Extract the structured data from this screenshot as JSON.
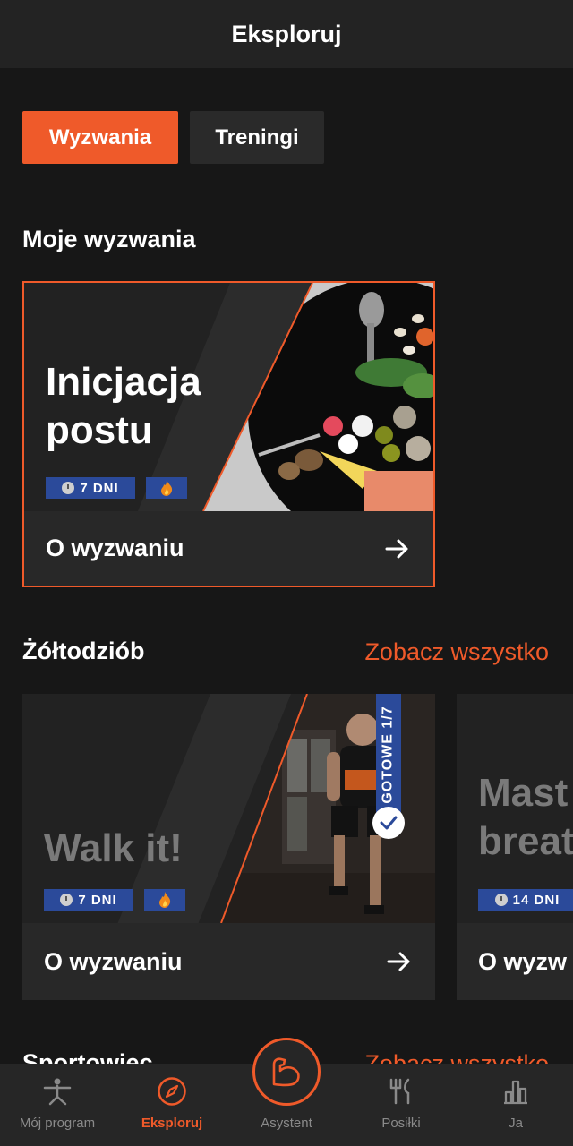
{
  "header": {
    "title": "Eksploruj"
  },
  "segments": [
    {
      "label": "Wyzwania",
      "active": true
    },
    {
      "label": "Treningi",
      "active": false
    }
  ],
  "my_challenges": {
    "section_title": "Moje wyzwania",
    "card": {
      "title_line1": "Inicjacja",
      "title_line2": "postu",
      "days_badge": "7 DNI",
      "difficulty_icon": "flame-icon",
      "action_label": "O wyzwaniu"
    }
  },
  "beginner": {
    "section_title": "Żółtodziób",
    "see_all": "Zobacz wszystko",
    "cards": [
      {
        "title": "Walk it!",
        "days_badge": "7 DNI",
        "difficulty_icon": "flame-icon",
        "progress": "GOTOWE 1/7",
        "action_label": "O wyzwaniu"
      },
      {
        "title_line1": "Mast",
        "title_line2": "breat",
        "days_badge": "14 DNI",
        "action_label": "O wyzw"
      }
    ]
  },
  "athlete": {
    "section_title": "Sportowiec",
    "see_all": "Zobacz wszystko"
  },
  "tabbar": {
    "items": [
      {
        "label": "Mój program",
        "icon": "yoga-pose-icon"
      },
      {
        "label": "Eksploruj",
        "icon": "compass-icon",
        "active": true
      },
      {
        "label": "Asystent",
        "icon": "bicep-icon"
      },
      {
        "label": "Posiłki",
        "icon": "cutlery-icon"
      },
      {
        "label": "Ja",
        "icon": "bar-chart-icon"
      }
    ]
  },
  "colors": {
    "accent": "#ef5a2a",
    "badge": "#2b4a9a",
    "background": "#171717",
    "card": "#262626"
  }
}
